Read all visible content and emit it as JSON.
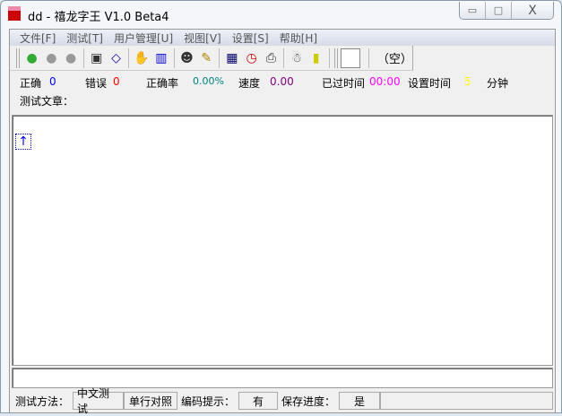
{
  "window": {
    "title": "dd - 禧龙字王 V1.0 Beta4",
    "minimize": "▭",
    "maximize": "□",
    "close": "X"
  },
  "menu": [
    "文件[F]",
    "测试[T]",
    "用户管理[U]",
    "视图[V]",
    "设置[S]",
    "帮助[H]"
  ],
  "toolbar": {
    "empty_label": "（空）",
    "icons": [
      "traffic-light-icon",
      "gray-light-icon",
      "gray-light-icon",
      "save-disk-icon",
      "eraser-icon",
      "hand-icon",
      "books-icon",
      "user-icon",
      "edit-icon",
      "calendar-icon",
      "clock-icon",
      "printer-icon",
      "person-icon",
      "exit-door-icon"
    ]
  },
  "stats": {
    "correct_label": "正确",
    "correct": "0",
    "error_label": "错误",
    "error": "0",
    "rate_label": "正确率",
    "rate": "0.00%",
    "speed_label": "速度",
    "speed": "0.00",
    "elapsed_label": "已过时间",
    "elapsed": "00:00",
    "set_label": "设置时间",
    "set": "5",
    "minutes": "分钟",
    "article_label": "测试文章："
  },
  "colors": {
    "correct": "#0000ff",
    "error": "#ff0000",
    "rate": "#008080",
    "speed": "#800080",
    "elapsed": "#ff00ff",
    "set": "#ffff00"
  },
  "status": {
    "method_label": "测试方法：",
    "method": "中文测试",
    "mode": "单行对照",
    "hint_label": "编码提示：",
    "hint": "有",
    "save_label": "保存进度：",
    "save": "是"
  },
  "cursor": "↑"
}
